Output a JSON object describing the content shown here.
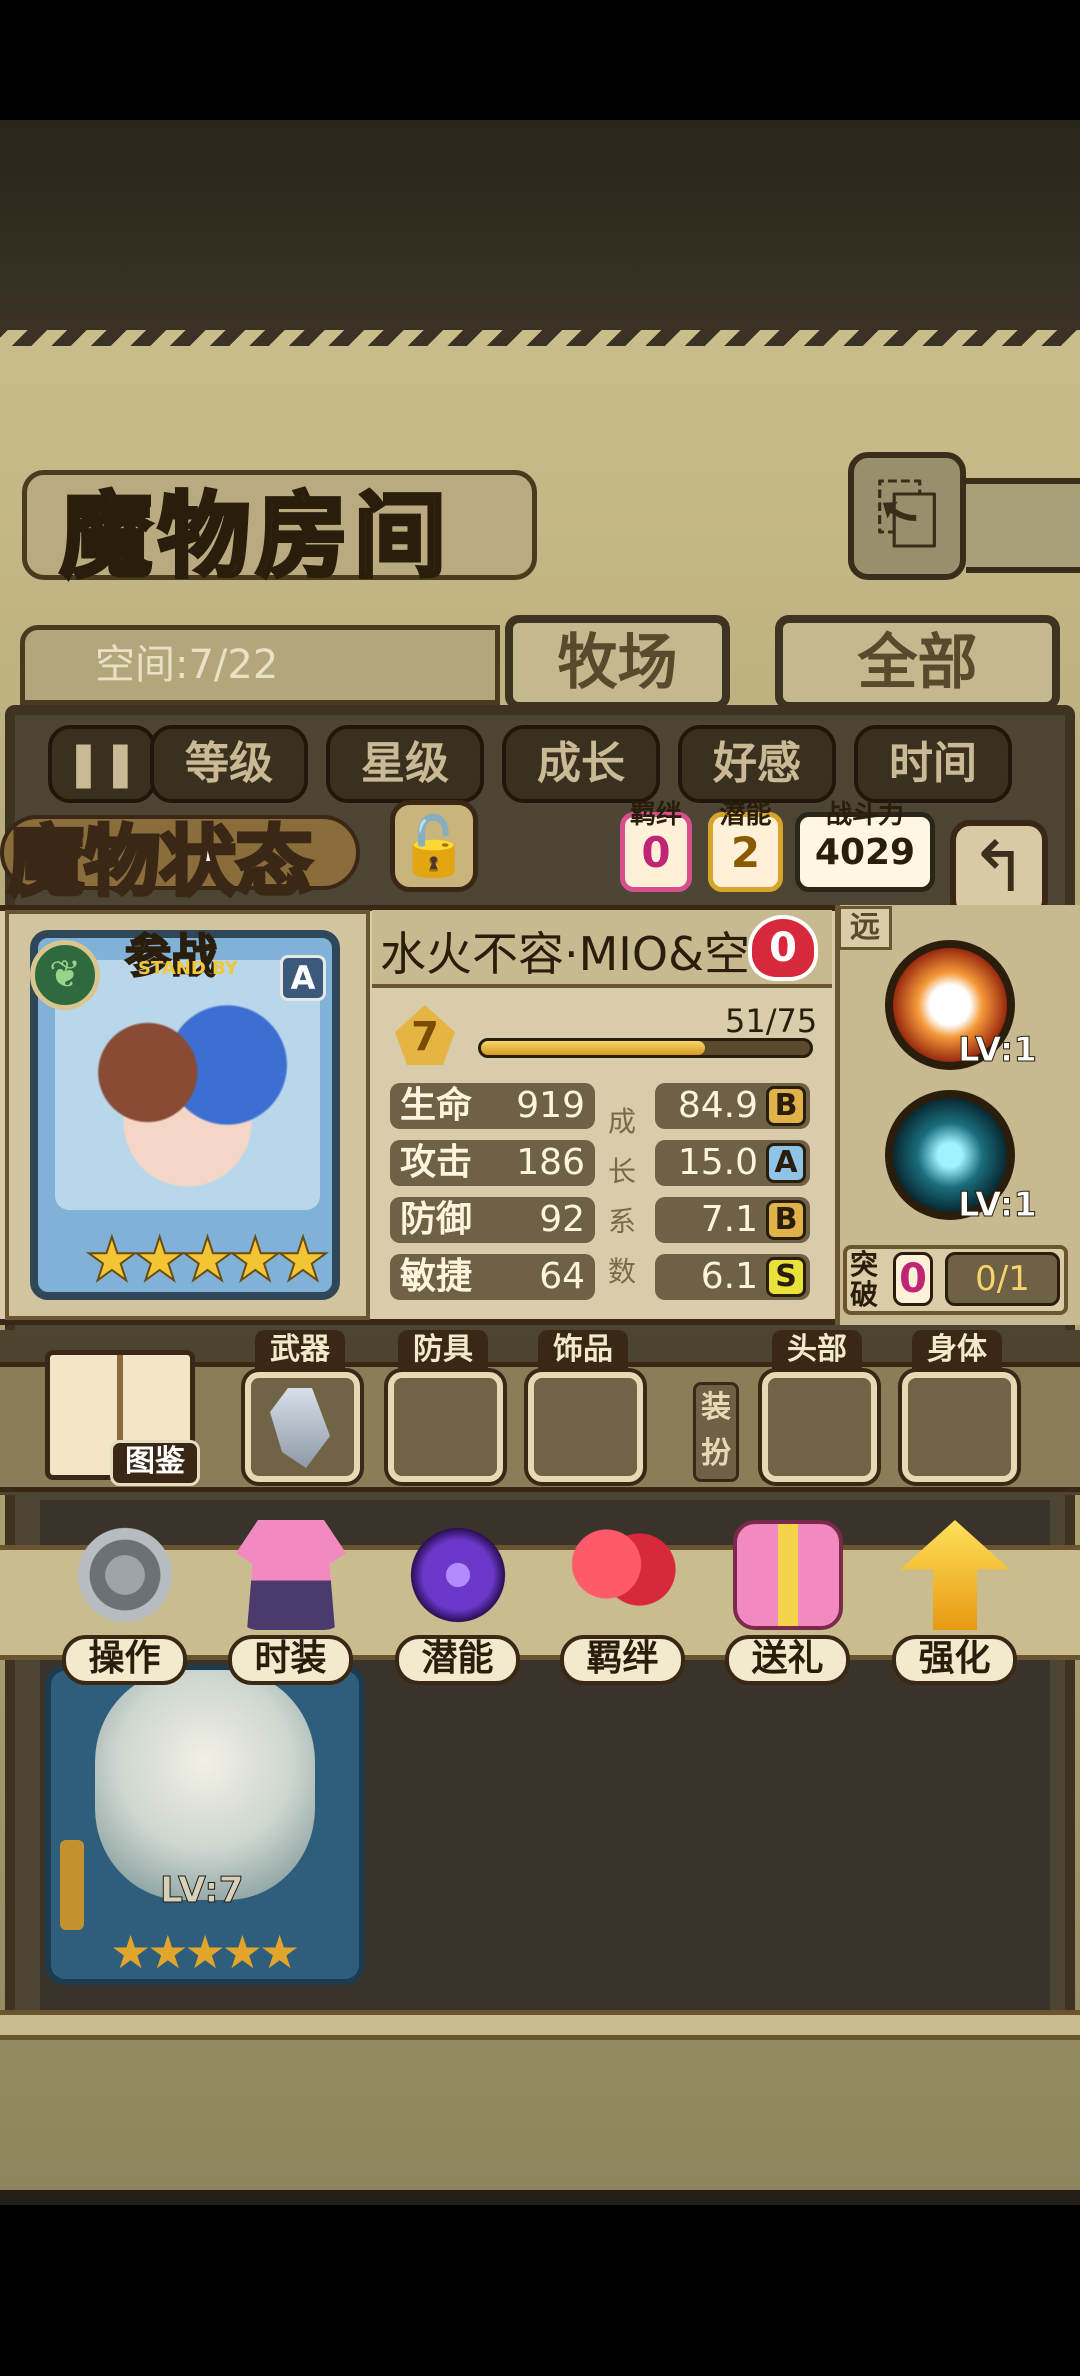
{
  "header": {
    "title": "魔物房间",
    "capacity": "空间:7/22",
    "tabs": [
      "牧场",
      "全部"
    ]
  },
  "sort_bar": {
    "toggle_icon": "pause-sort-icon",
    "options": [
      "等级",
      "星级",
      "成长",
      "好感",
      "时间"
    ]
  },
  "status": {
    "title": "魔物状态",
    "bond_label": "羁绊",
    "bond_value": "0",
    "potential_label": "潜能",
    "potential_value": "2",
    "combat_power_label": "战斗力",
    "combat_power_value": "4029",
    "lock_icon": "unlocked-padlock-icon",
    "back_icon": "return-arrow-icon"
  },
  "monster": {
    "name": "水火不容·MIO&空",
    "affection": "0",
    "standby_label": "参战",
    "standby_sub": "STAND BY",
    "rank": "A",
    "stars": 5,
    "stars_text": "★★★★★",
    "element_icon": "leaf-element-icon",
    "level": "7",
    "xp": "51/75",
    "xp_current": 51,
    "xp_max": 75
  },
  "stats": [
    {
      "label": "生命",
      "value": "919",
      "growth": "84.9",
      "grade": "B",
      "grade_color": "#e0b24a"
    },
    {
      "label": "攻击",
      "value": "186",
      "growth": "15.0",
      "grade": "A",
      "grade_color": "#8fc4e6"
    },
    {
      "label": "防御",
      "value": "92",
      "growth": "7.1",
      "grade": "B",
      "grade_color": "#e0b24a"
    },
    {
      "label": "敏捷",
      "value": "64",
      "growth": "6.1",
      "grade": "S",
      "grade_color": "#e8e23a"
    }
  ],
  "growth_coefficient_label": [
    "成",
    "长",
    "系",
    "数"
  ],
  "skills": {
    "range": "远",
    "skill1_level": "LV:1",
    "skill2_level": "LV:1",
    "breakthrough_label": "突破",
    "breakthrough_count": "0",
    "breakthrough_progress": "0/1"
  },
  "equipment": {
    "handbook_label": "图鉴",
    "slots": [
      "武器",
      "防具",
      "饰品",
      "头部",
      "身体"
    ],
    "dress_up": "装扮"
  },
  "actions": [
    "操作",
    "时装",
    "潜能",
    "羁绊",
    "送礼",
    "强化"
  ],
  "background_card": {
    "level": "LV:7",
    "stars": "★★★★★"
  },
  "colors": {
    "parchment": "#c9bd8a",
    "frame": "#3a2715",
    "xp_fill": "#e3a82e",
    "bond": "#d84f8e",
    "potential": "#d7a52a"
  }
}
